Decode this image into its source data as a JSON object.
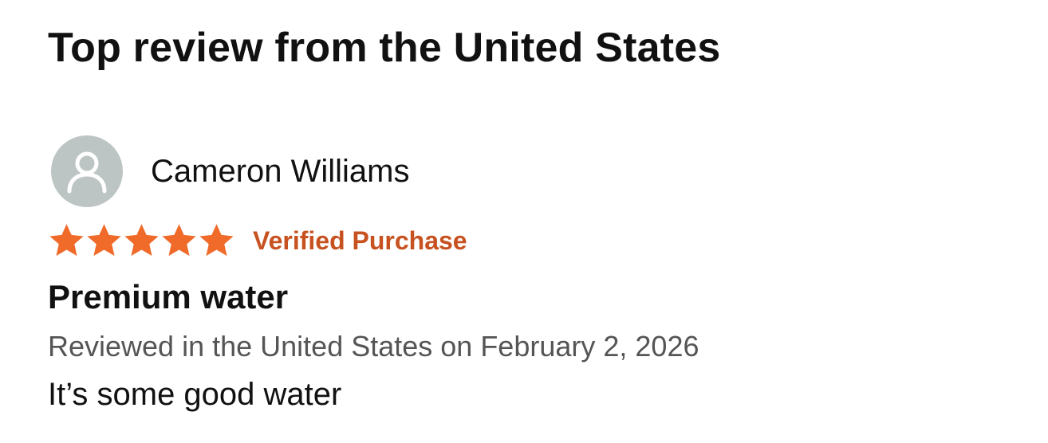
{
  "section": {
    "title": "Top review from the United States"
  },
  "review": {
    "author": "Cameron Williams",
    "avatar_icon": "user-silhouette-icon",
    "rating": 5,
    "rating_max": 5,
    "star_icon": "star-icon",
    "verified_label": "Verified Purchase",
    "title": "Premium water",
    "meta": "Reviewed in the United States on February 2, 2026",
    "body": "It’s some good water"
  },
  "colors": {
    "star": "#f06a2a",
    "verified": "#c7511f",
    "avatar_bg": "#bcc4c4",
    "avatar_fg": "#ffffff",
    "meta_text": "#555555"
  }
}
